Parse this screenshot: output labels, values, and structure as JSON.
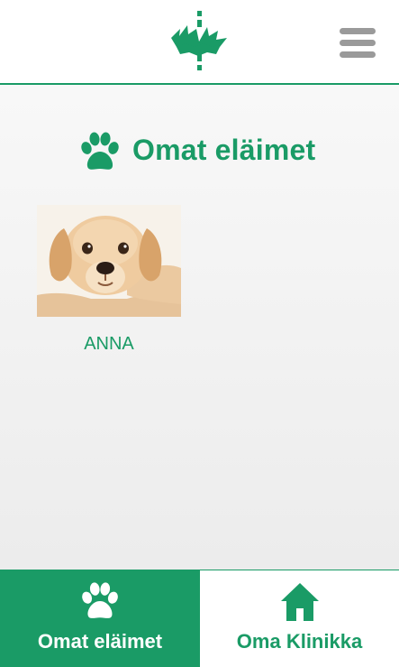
{
  "header": {
    "logo_icon": "university-of-helsinki-flame-logo",
    "menu_icon": "hamburger-menu-icon"
  },
  "main": {
    "title": "Omat eläimet",
    "title_icon": "paw-icon",
    "pets": [
      {
        "name": "ANNA",
        "photo": "golden-retriever-puppy-photo"
      }
    ]
  },
  "nav": {
    "items": [
      {
        "label": "Omat eläimet",
        "icon": "paw-icon",
        "active": true
      },
      {
        "label": "Oma Klinikka",
        "icon": "home-icon",
        "active": false
      }
    ]
  },
  "colors": {
    "brand_green": "#1a9b66",
    "menu_gray": "#9a9a9a",
    "background": "#f2f2f2"
  }
}
